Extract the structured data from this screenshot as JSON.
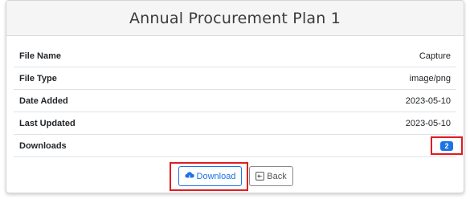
{
  "header": {
    "title": "Annual Procurement Plan 1"
  },
  "details": [
    {
      "label": "File Name",
      "value": "Capture"
    },
    {
      "label": "File Type",
      "value": "image/png"
    },
    {
      "label": "Date Added",
      "value": "2023-05-10"
    },
    {
      "label": "Last Updated",
      "value": "2023-05-10"
    }
  ],
  "downloads": {
    "label": "Downloads",
    "count": "2"
  },
  "actions": {
    "download_label": "Download",
    "download_icon": "cloud-download-icon",
    "back_label": "Back",
    "back_icon": "arrow-left-box-icon"
  },
  "colors": {
    "accent": "#1a73e8",
    "highlight": "#e21b22",
    "header_bg": "#f5f5f5"
  }
}
